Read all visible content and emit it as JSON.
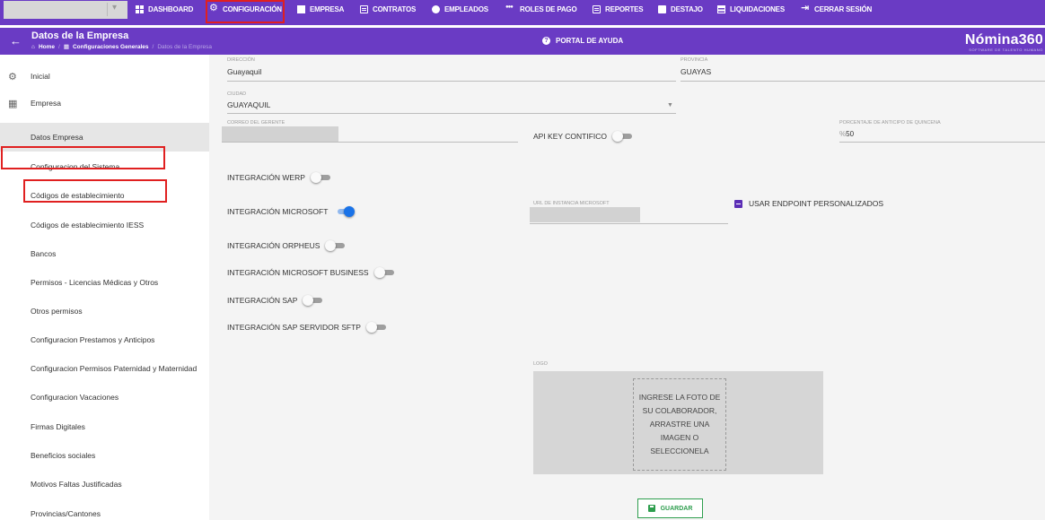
{
  "topnav": {
    "items": [
      {
        "label": "DASHBOARD",
        "icon": "dashboard-icon"
      },
      {
        "label": "CONFIGURACIÓN",
        "icon": "gear-icon"
      },
      {
        "label": "EMPRESA",
        "icon": "building-icon"
      },
      {
        "label": "CONTRATOS",
        "icon": "contract-icon"
      },
      {
        "label": "EMPLEADOS",
        "icon": "employee-icon"
      },
      {
        "label": "ROLES DE PAGO",
        "icon": "users-icon"
      },
      {
        "label": "REPORTES",
        "icon": "report-icon"
      },
      {
        "label": "DESTAJO",
        "icon": "document-icon"
      },
      {
        "label": "LIQUIDACIONES",
        "icon": "list-icon"
      },
      {
        "label": "CERRAR SESIÓN",
        "icon": "logout-icon"
      }
    ]
  },
  "header": {
    "title": "Datos de la Empresa",
    "breadcrumb": [
      "Home",
      "Configuraciones Generales",
      "Datos de la Empresa"
    ],
    "help_label": "PORTAL DE AYUDA",
    "brand_name": "Nómina360",
    "brand_tagline": "SOFTWARE DE TALENTO HUMANO"
  },
  "sidebar": {
    "items": [
      {
        "label": "Inicial"
      },
      {
        "label": "Empresa"
      },
      {
        "label": "Datos Empresa"
      },
      {
        "label": "Configuracion del Sistema"
      },
      {
        "label": "Códigos de establecimiento"
      },
      {
        "label": "Códigos de establecimiento IESS"
      },
      {
        "label": "Bancos"
      },
      {
        "label": "Permisos - Licencias Médicas y Otros"
      },
      {
        "label": "Otros permisos"
      },
      {
        "label": "Configuracion Prestamos y Anticipos"
      },
      {
        "label": "Configuracion Permisos Paternidad y Maternidad"
      },
      {
        "label": "Configuracion Vacaciones"
      },
      {
        "label": "Firmas Digitales"
      },
      {
        "label": "Beneficios sociales"
      },
      {
        "label": "Motivos Faltas Justificadas"
      },
      {
        "label": "Provincias/Cantones"
      }
    ]
  },
  "form": {
    "direccion": {
      "label": "DIRECCIÓN",
      "value": "Guayaquil"
    },
    "provincia": {
      "label": "PROVINCIA",
      "value": "GUAYAS"
    },
    "ciudad": {
      "label": "CIUDAD",
      "value": "GUAYAQUIL"
    },
    "correo_gerente": {
      "label": "CORREO DEL GERENTE"
    },
    "api_key": {
      "label": "API KEY CONTIFICO",
      "enabled": false
    },
    "porcentaje_anticipo": {
      "label": "PORCENTAJE DE ANTICIPO DE QUINCENA",
      "prefix": "%",
      "value": "50"
    },
    "integraciones": [
      {
        "label": "INTEGRACIÓN WERP",
        "enabled": false
      },
      {
        "label": "INTEGRACIÓN MICROSOFT",
        "enabled": true
      },
      {
        "label": "INTEGRACIÓN ORPHEUS",
        "enabled": false
      },
      {
        "label": "INTEGRACIÓN MICROSOFT BUSINESS",
        "enabled": false
      },
      {
        "label": "INTEGRACIÓN SAP",
        "enabled": false
      },
      {
        "label": "INTEGRACIÓN SAP SERVIDOR SFTP",
        "enabled": false
      }
    ],
    "url_microsoft": {
      "label": "URL DE INSTANCIA MICROSOFT"
    },
    "endpoint_personalizados": {
      "label": "USAR ENDPOINT PERSONALIZADOS",
      "checked": true
    },
    "logo": {
      "label": "LOGO",
      "dropzone_text": "INGRESE LA FOTO DE SU COLABORADOR, ARRASTRE UNA IMAGEN O SELECCIONELA"
    },
    "save_label": "GUARDAR"
  },
  "colors": {
    "primary": "#6a3bc4",
    "highlight": "#e02020",
    "save": "#2e9e4e",
    "toggle_on": "#1a73e8"
  }
}
